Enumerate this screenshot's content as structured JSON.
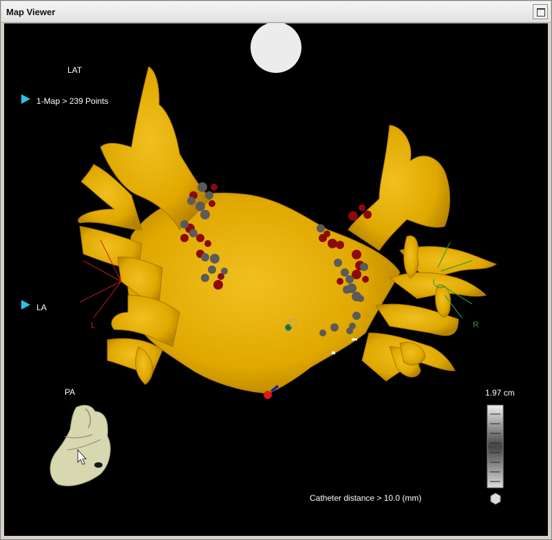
{
  "window": {
    "title": "Map Viewer",
    "maximize_icon": "maximize-icon"
  },
  "viewport": {
    "top_label": "LAT",
    "map_label": "1-Map > 239 Points",
    "chamber_label": "LA",
    "orientation_label": "PA",
    "axis_left": "L",
    "axis_right": "R",
    "scale_value": "1.97 cm",
    "catheter_text": "Catheter distance > 10.0 (mm)",
    "colors": {
      "anatomy": "#e6b000",
      "lesion": "#8c0a0a",
      "point": "#5a5a5a",
      "marker": "#29c3e6"
    }
  }
}
